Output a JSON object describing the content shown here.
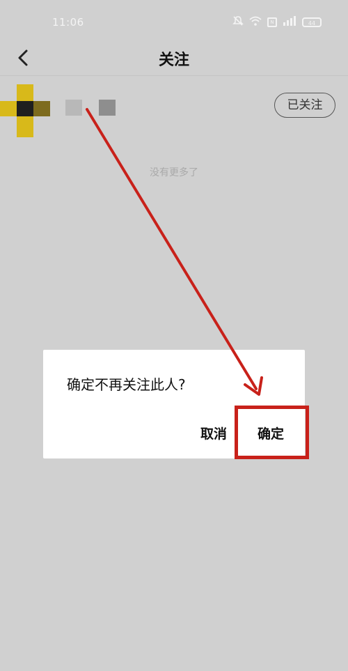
{
  "status_bar": {
    "time": "11:06",
    "battery": "44"
  },
  "header": {
    "title": "关注"
  },
  "follow_list": {
    "items": [
      {
        "followed_label": "已关注"
      }
    ],
    "end_text": "没有更多了"
  },
  "dialog": {
    "message": "确定不再关注此人?",
    "cancel_label": "取消",
    "confirm_label": "确定"
  },
  "annotation": {
    "color": "#c8211a"
  }
}
